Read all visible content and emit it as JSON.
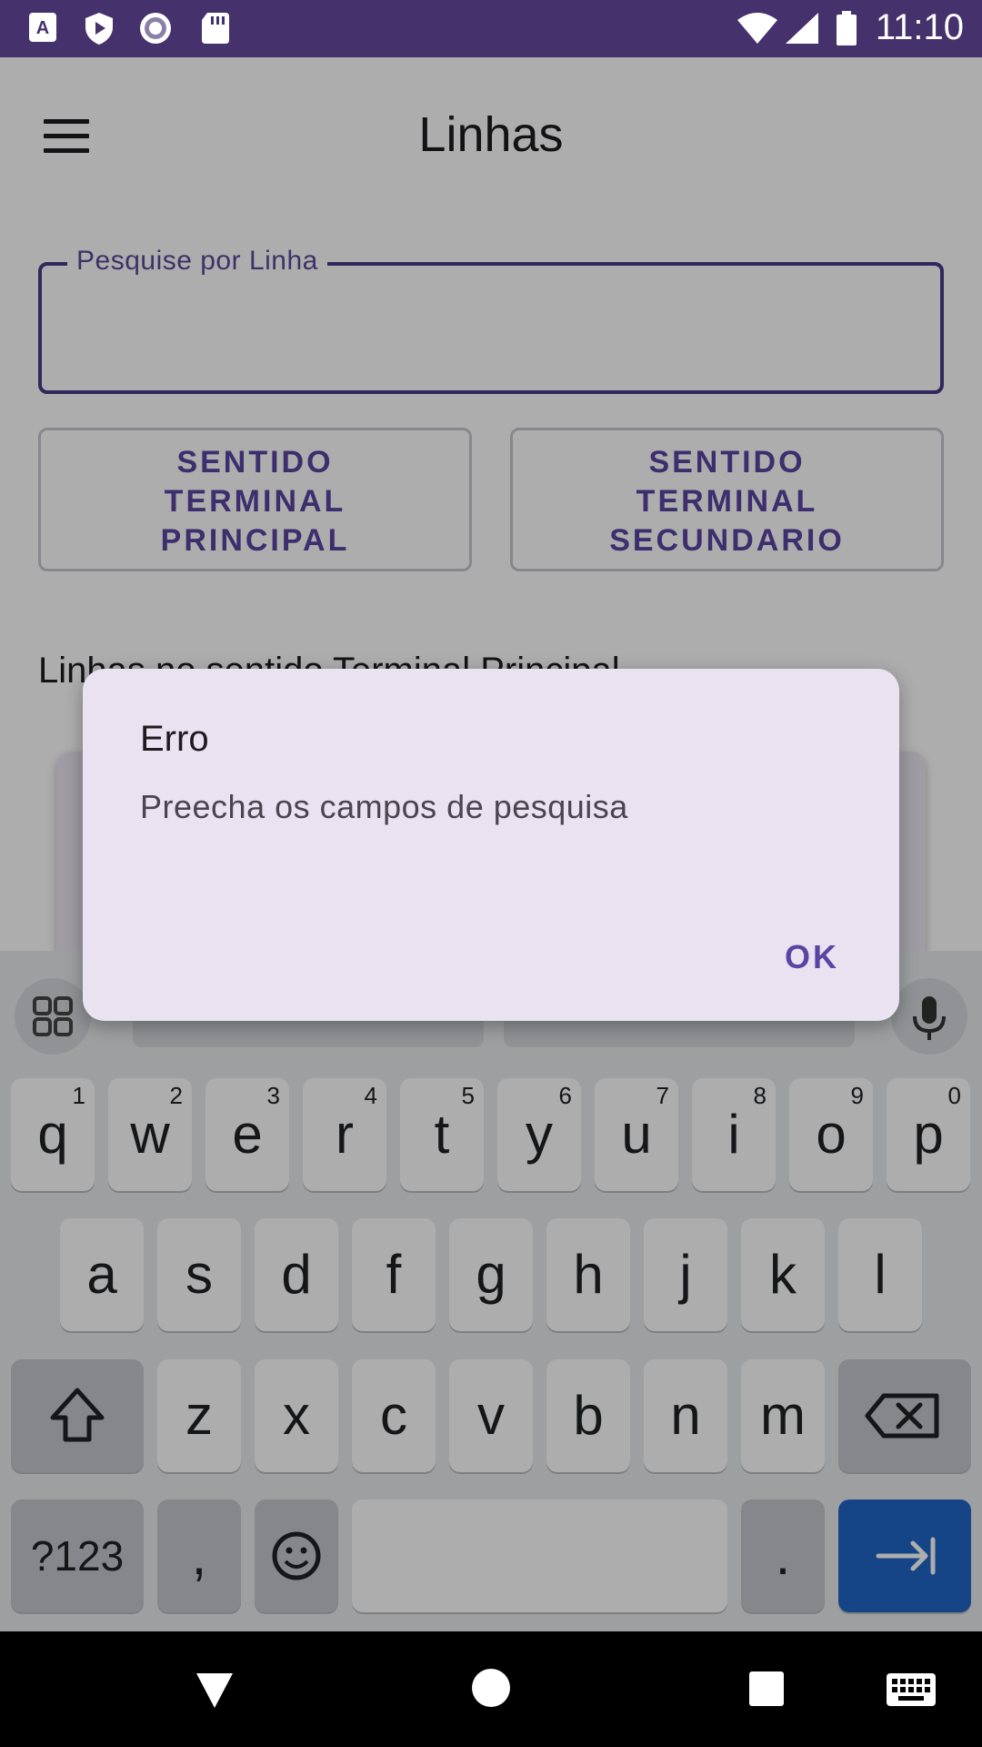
{
  "status_bar": {
    "time": "11:10",
    "left_icons": [
      "app-a-icon",
      "shield-play-icon",
      "record-icon",
      "sd-card-icon"
    ],
    "right_icons": [
      "wifi-icon",
      "signal-icon",
      "battery-icon"
    ],
    "background": "#45316c"
  },
  "app": {
    "title": "Linhas",
    "search": {
      "label": "Pesquise por Linha",
      "value": ""
    },
    "buttons": {
      "principal": "SENTIDO\nTERMINAL\nPRINCIPAL",
      "secundario": "SENTIDO\nTERMINAL\nSECUNDARIO"
    },
    "section_title": "Linhas no sentido Terminal Principal",
    "accent_color": "#5b45a2"
  },
  "dialog": {
    "title": "Erro",
    "message": "Preecha os campos de pesquisa",
    "ok_label": "OK"
  },
  "keyboard": {
    "row1": [
      {
        "key": "q",
        "hint": "1"
      },
      {
        "key": "w",
        "hint": "2"
      },
      {
        "key": "e",
        "hint": "3"
      },
      {
        "key": "r",
        "hint": "4"
      },
      {
        "key": "t",
        "hint": "5"
      },
      {
        "key": "y",
        "hint": "6"
      },
      {
        "key": "u",
        "hint": "7"
      },
      {
        "key": "i",
        "hint": "8"
      },
      {
        "key": "o",
        "hint": "9"
      },
      {
        "key": "p",
        "hint": "0"
      }
    ],
    "row2": [
      "a",
      "s",
      "d",
      "f",
      "g",
      "h",
      "j",
      "k",
      "l"
    ],
    "row3": [
      "z",
      "x",
      "c",
      "v",
      "b",
      "n",
      "m"
    ],
    "symbols_label": "?123",
    "comma": ",",
    "period": ".",
    "enter_color": "#1f66c8"
  },
  "nav_bar": {
    "icons": [
      "back-triangle-icon",
      "home-circle-icon",
      "recents-square-icon",
      "keyboard-icon"
    ]
  }
}
